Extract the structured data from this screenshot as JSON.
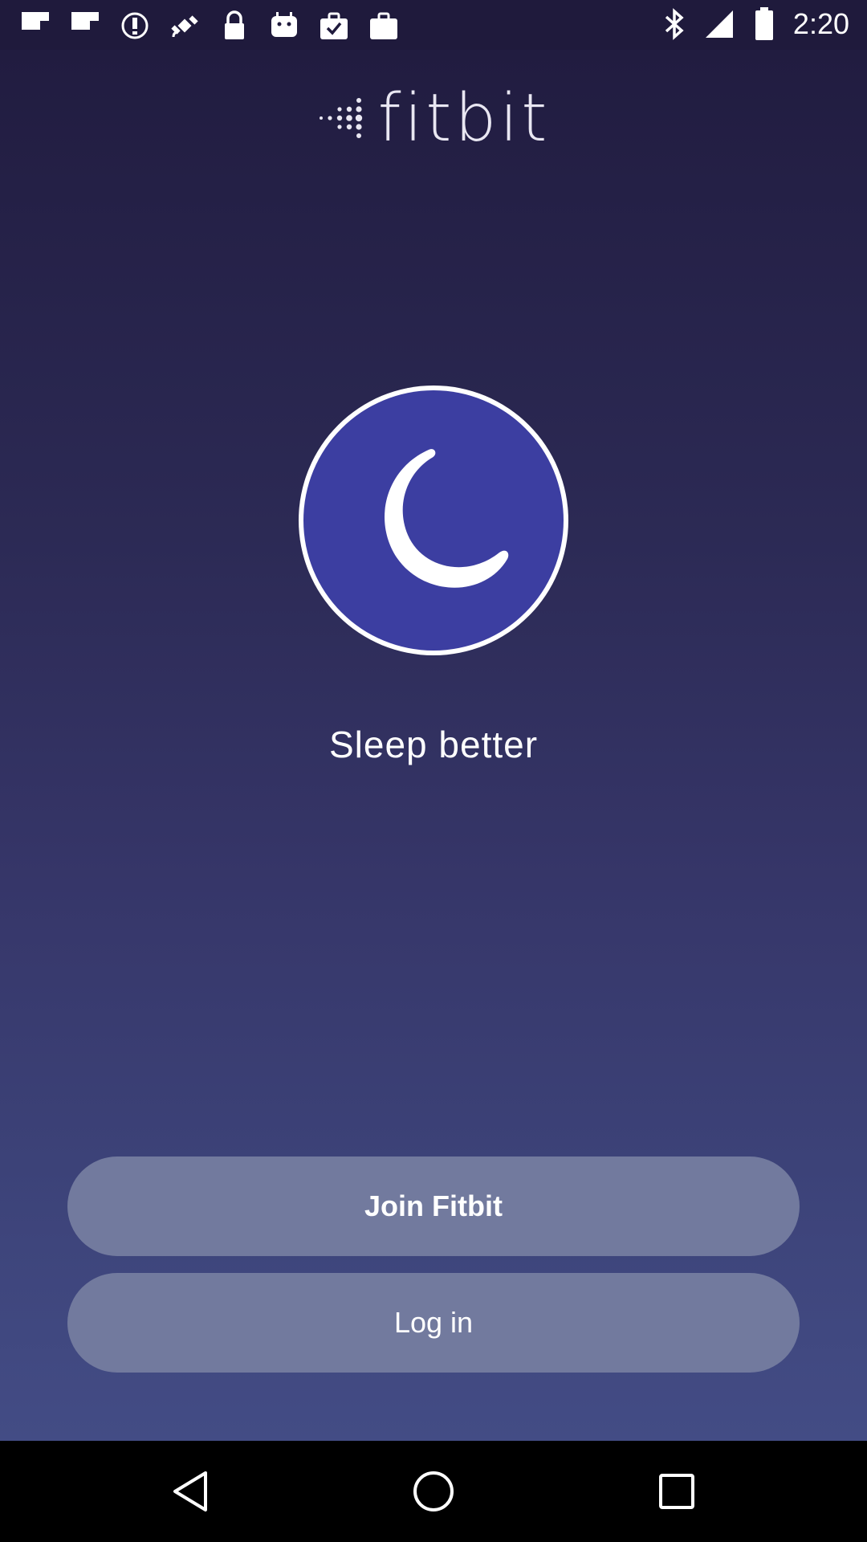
{
  "status_bar": {
    "time": "2:20",
    "left_icons": [
      "flipboard-icon",
      "flipboard-icon",
      "alert-circle-icon",
      "fake-gps-satellite-icon",
      "lock-icon",
      "android-bot-icon",
      "task-check-icon",
      "briefcase-icon"
    ],
    "right_icons": [
      "bluetooth-icon",
      "signal-icon",
      "battery-icon"
    ]
  },
  "app": {
    "logo_text": "fitbit",
    "feature_icon": "moon-icon",
    "headline": "Sleep better",
    "join_button": "Join Fitbit",
    "login_button": "Log in",
    "colors": {
      "background_top": "#211c40",
      "background_bottom": "#434c85",
      "icon_circle": "#3c3ea1",
      "button": "#727a9e"
    }
  },
  "nav_bar": {
    "buttons": [
      "back-icon",
      "home-icon",
      "recent-apps-icon"
    ]
  }
}
